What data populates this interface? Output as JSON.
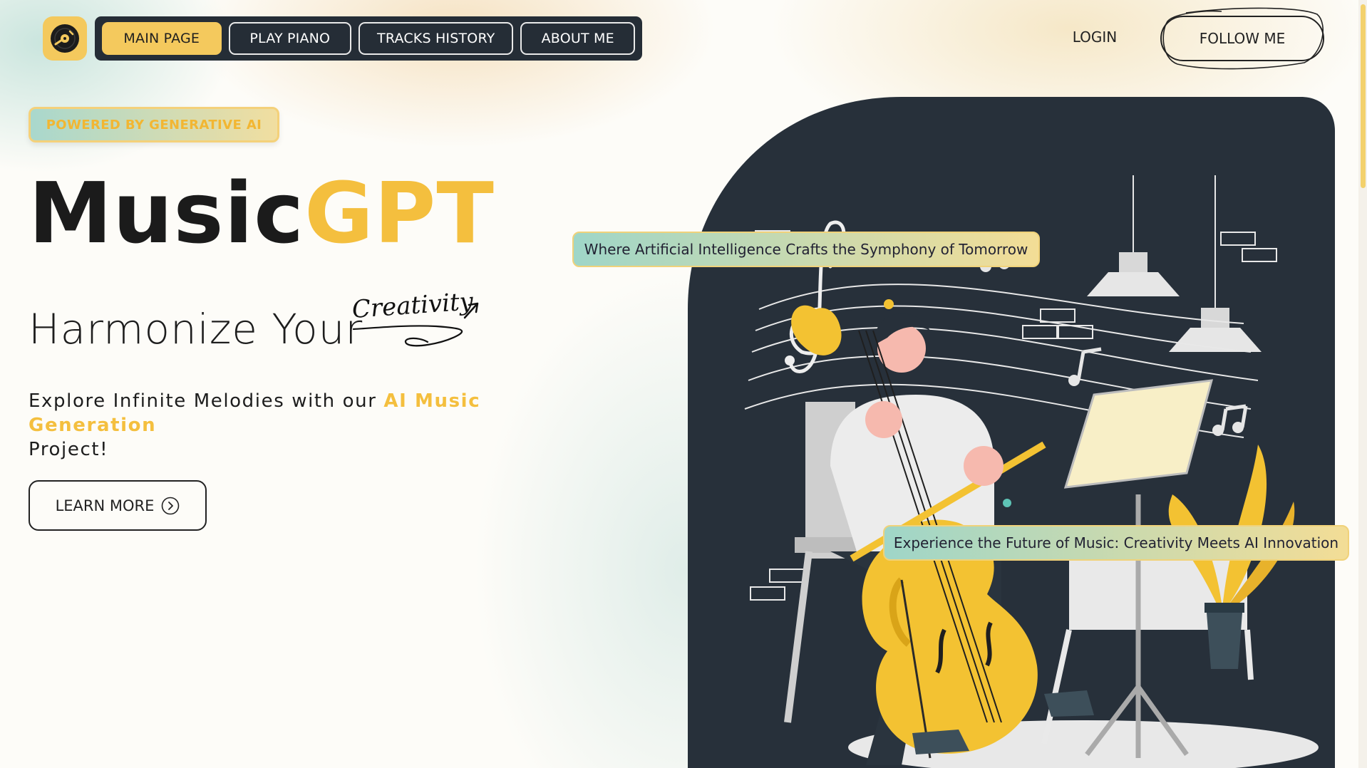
{
  "nav": {
    "items": [
      {
        "label": "MAIN PAGE",
        "active": true
      },
      {
        "label": "PLAY PIANO",
        "active": false
      },
      {
        "label": "TRACKS HISTORY",
        "active": false
      },
      {
        "label": "ABOUT ME",
        "active": false
      }
    ],
    "login_label": "LOGIN",
    "follow_label": "FOLLOW ME"
  },
  "logo": {
    "icon": "vinyl-record-icon"
  },
  "hero": {
    "badge": "POWERED BY GENERATIVE AI",
    "title_main": "Music",
    "title_accent": "GPT",
    "subtitle": "Harmonize Your",
    "subtitle_script": "Creativity",
    "description_pre": "Explore Infinite Melodies with our ",
    "description_highlight": "AI Music Generation",
    "description_post": "Project!",
    "cta_label": "LEARN MORE",
    "cta_icon": "chevron-right-circle-icon"
  },
  "captions": {
    "top": "Where Artificial Intelligence Crafts the Symphony of Tomorrow",
    "bottom": "Experience the Future of Music: Creativity Meets AI Innovation"
  },
  "colors": {
    "accent": "#f4bf3e",
    "dark": "#252d36",
    "panel": "#27303a"
  }
}
